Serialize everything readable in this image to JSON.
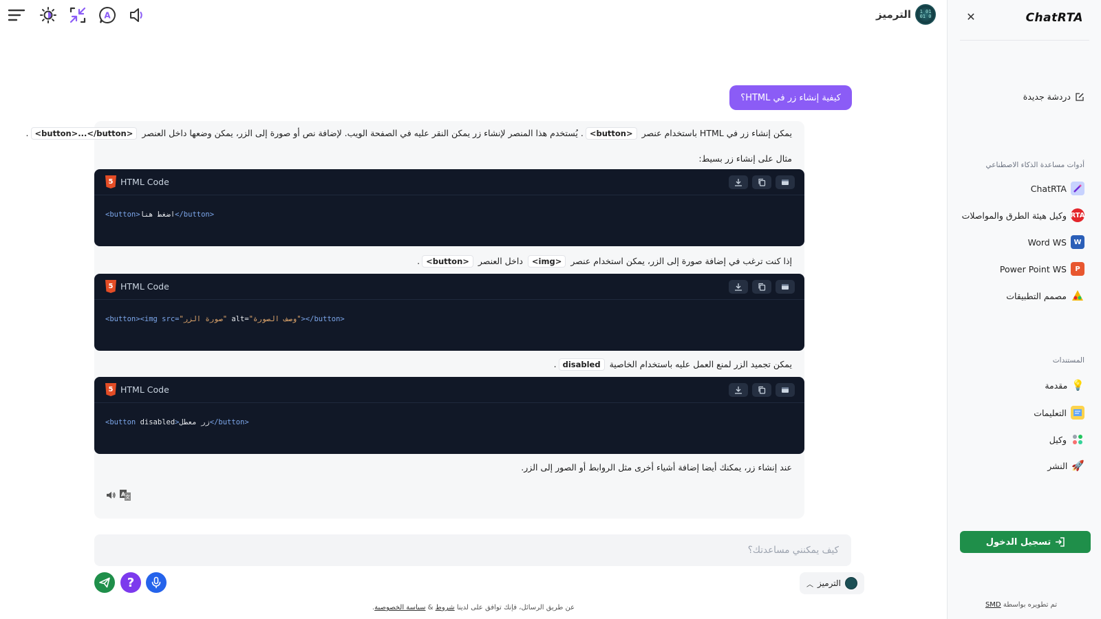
{
  "header": {
    "brand_name": "الترميز",
    "logo_text": "01 10 01",
    "icons": [
      "menu-lines-icon",
      "sun-brightness-icon",
      "collapse-arrows-icon",
      "a-badge-icon",
      "speaker-icon"
    ]
  },
  "chat": {
    "user_message": "كيفية إنشاء زر في HTML؟",
    "intro": {
      "before": "يمكن إنشاء زر في HTML باستخدام عنصر",
      "code1": "<button>",
      "middle": ". يُستخدم هذا المنصر لإنشاء زر يمكن النقر عليه في الصفحة الويب. لإضافة نص أو صورة إلى الزر، يمكن وضعها داخل العنصر",
      "code2": "<button>...</button>",
      "end": "."
    },
    "example_label": "مثال على إنشاء زر بسيط:",
    "code_blocks": [
      {
        "title": "HTML Code",
        "line": {
          "open": "<button>",
          "text": "اضغط هنا",
          "close": "</button>"
        }
      },
      {
        "title": "HTML Code",
        "line": {
          "open": "<button><img src=",
          "src": "\"صورة الزر\"",
          "alt_attr": " alt=",
          "alt": "\"وصف الصورة\"",
          "close": "></button>"
        }
      },
      {
        "title": "HTML Code",
        "line": {
          "open": "<button",
          "attr": " disabled",
          "text": "زر معطل",
          "gt": ">",
          "close": "</button>"
        }
      }
    ],
    "image_para": {
      "before": "إذا كنت ترغب في إضافة صورة إلى الزر، يمكن استخدام عنصر",
      "code1": "<img>",
      "middle": "داخل العنصر",
      "code2": "<button>",
      "end": "."
    },
    "disabled_para": {
      "before": "يمكن تجميد الزر لمنع العمل عليه باستخدام الخاصية",
      "code": "disabled",
      "end": "."
    },
    "closing": "عند إنشاء زر، يمكنك أيضا إضافة أشياء أخرى مثل الروابط أو الصور إلى الزر."
  },
  "input": {
    "placeholder": "كيف يمكنني مساعدتك؟",
    "model_label": "الترميز"
  },
  "disclaimer": {
    "text": "عن طريق الرسائل، فإنك توافق على لدينا",
    "terms": "شروط",
    "amp": "&",
    "privacy": "سياسة الخصوصية",
    "dot": "."
  },
  "sidebar": {
    "title": "ChatRTA",
    "new_chat": "دردشة جديدة",
    "tools_heading": "أدوات مساعدة الذكاء الاصطناعي",
    "tools": [
      {
        "label": "ChatRTA",
        "color": "#7c8cf0"
      },
      {
        "label": "وكيل هيئة الطرق والمواصلات",
        "color": "#e3262b"
      },
      {
        "label": "Word WS",
        "color": "#2b5fb8"
      },
      {
        "label": "Power Point WS",
        "color": "#e8572f"
      },
      {
        "label": "مصمم التطبيقات",
        "color": "#f5b400"
      }
    ],
    "docs_heading": "المستندات",
    "docs": [
      {
        "label": "مقدمة"
      },
      {
        "label": "التعليمات"
      },
      {
        "label": "وكيل"
      },
      {
        "label": "النشر"
      }
    ],
    "login": "تسجيل الدخول",
    "credit_text": "تم تطويره بواسطة",
    "credit_link": "SMD"
  },
  "colors": {
    "accent_purple": "#8b5cf6",
    "send_green": "#1f8f4a",
    "help_purple": "#7c3aed",
    "mic_blue": "#2563eb",
    "code_bg": "#111827"
  }
}
